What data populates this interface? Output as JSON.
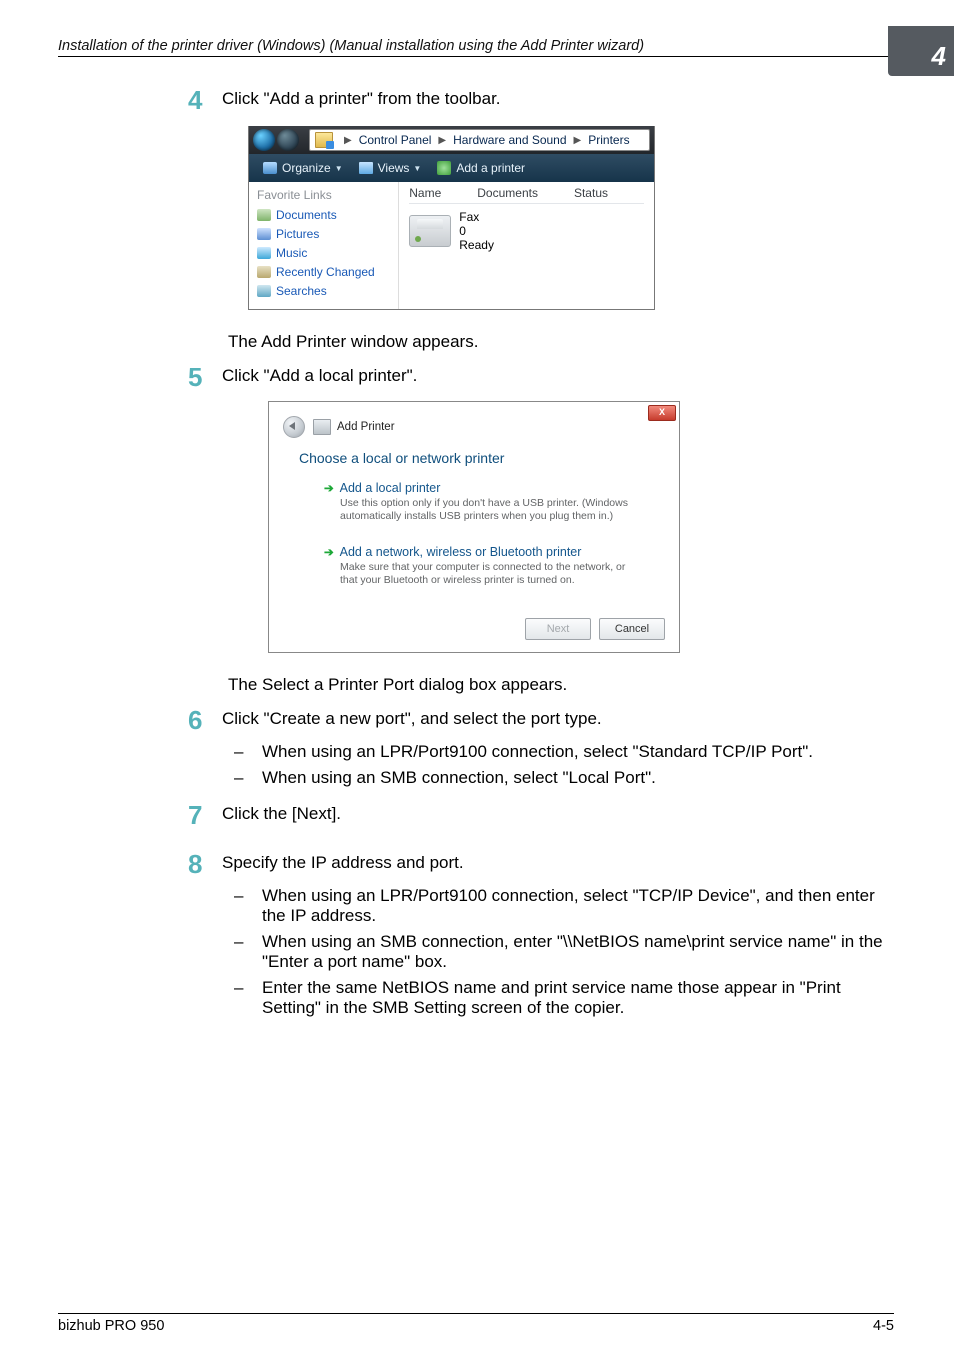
{
  "header": {
    "title": "Installation of the printer driver (Windows) (Manual installation using the Add Printer wizard)",
    "chapter_number": "4"
  },
  "step4": {
    "num": "4",
    "text": "Click \"Add a printer\" from the toolbar."
  },
  "ss1": {
    "crumbs": {
      "root_label": "Control Panel",
      "mid_label": "Hardware and Sound",
      "end_label": "Printers"
    },
    "toolbar": {
      "organize": "Organize",
      "views": "Views",
      "add_printer": "Add a printer"
    },
    "side": {
      "title": "Favorite Links",
      "items": [
        "Documents",
        "Pictures",
        "Music",
        "Recently Changed",
        "Searches"
      ]
    },
    "cols": {
      "name": "Name",
      "documents": "Documents",
      "status": "Status"
    },
    "fax": {
      "name": "Fax",
      "count": "0",
      "state": "Ready"
    }
  },
  "para_after_ss1": "The Add Printer window appears.",
  "step5": {
    "num": "5",
    "text": "Click \"Add a local printer\"."
  },
  "ss2": {
    "close": "X",
    "title": "Add Printer",
    "subtitle": "Choose a local or network printer",
    "opt1": {
      "title": "Add a local printer",
      "desc": "Use this option only if you don't have a USB printer. (Windows automatically installs USB printers when you plug them in.)"
    },
    "opt2": {
      "title": "Add a network, wireless or Bluetooth printer",
      "desc": "Make sure that your computer is connected to the network, or that your Bluetooth or wireless printer is turned on."
    },
    "btn_next": "Next",
    "btn_cancel": "Cancel"
  },
  "para_after_ss2": "The Select a Printer Port dialog box appears.",
  "step6": {
    "num": "6",
    "text": "Click \"Create a new port\", and select the port type.",
    "bullets": [
      "When using an LPR/Port9100 connection, select \"Standard TCP/IP Port\".",
      "When using an SMB connection, select \"Local Port\"."
    ]
  },
  "step7": {
    "num": "7",
    "text": "Click the [Next]."
  },
  "step8": {
    "num": "8",
    "text": "Specify the IP address and port.",
    "bullets": [
      "When using an LPR/Port9100 connection, select \"TCP/IP Device\", and then enter the IP address.",
      "When using an SMB connection, enter \"\\\\NetBIOS name\\print service name\" in the \"Enter a port name\" box.",
      "Enter the same NetBIOS name and print service name those appear in \"Print Setting\" in the SMB Setting screen of the copier."
    ]
  },
  "footer": {
    "left": "bizhub PRO 950",
    "right": "4-5"
  }
}
